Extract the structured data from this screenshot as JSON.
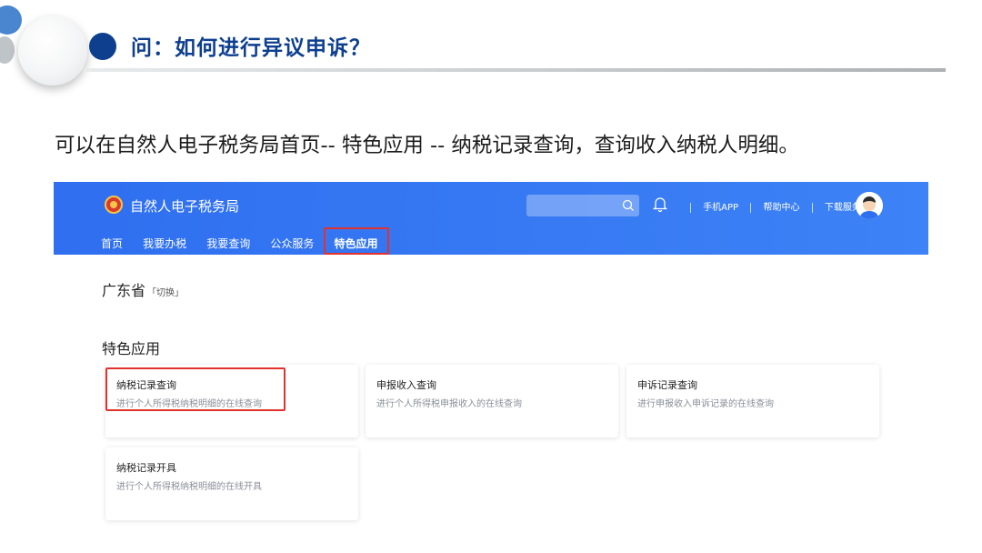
{
  "slide": {
    "heading": "问：如何进行异议申诉？",
    "intro": "可以在自然人电子税务局首页-- 特色应用 -- 纳税记录查询，查询收入纳税人明细。"
  },
  "portal": {
    "brand": "自然人电子税务局",
    "top_links": [
      "手机APP",
      "帮助中心",
      "下载服务"
    ],
    "nav": [
      "首页",
      "我要办税",
      "我要查询",
      "公众服务",
      "特色应用"
    ],
    "active_nav": "特色应用",
    "province": "广东省",
    "province_switch": "「切换」",
    "section_title": "特色应用",
    "cards": [
      {
        "title": "纳税记录查询",
        "desc": "进行个人所得税纳税明细的在线查询"
      },
      {
        "title": "申报收入查询",
        "desc": "进行个人所得税申报收入的在线查询"
      },
      {
        "title": "申诉记录查询",
        "desc": "进行申报收入申诉记录的在线查询"
      },
      {
        "title": "纳税记录开具",
        "desc": "进行个人所得税纳税明细的在线开具"
      }
    ]
  },
  "colors": {
    "header_blue": "#3478f6",
    "heading_navy": "#0e3f8f",
    "highlight_red": "#e2322e"
  },
  "icons": [
    "search-icon",
    "bell-icon",
    "avatar",
    "emblem-icon"
  ]
}
